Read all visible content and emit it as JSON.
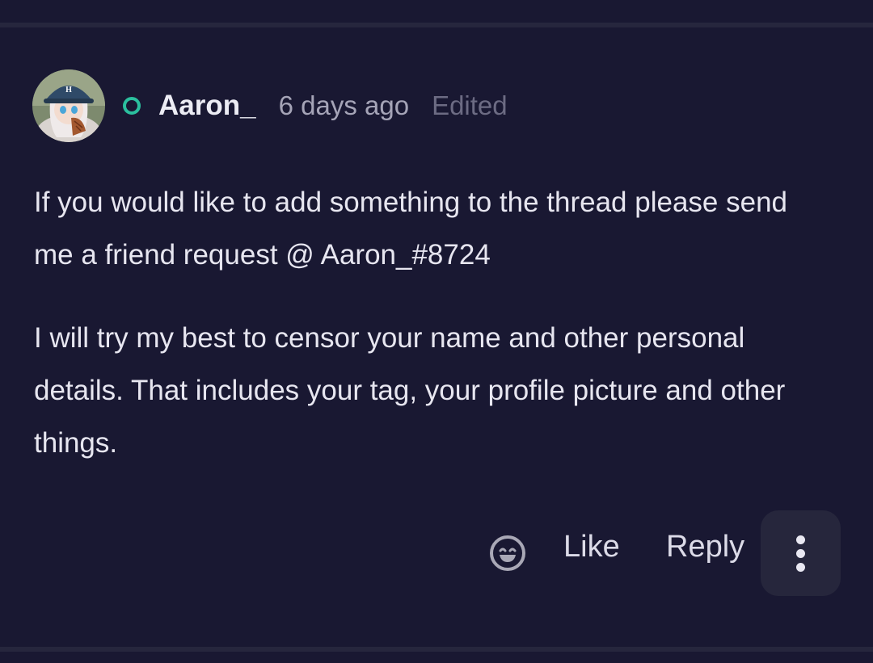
{
  "post": {
    "author": {
      "name": "Aaron_",
      "avatar_icon": "anime-avatar-icon",
      "status": "online",
      "status_color": "#2bbf9e"
    },
    "timestamp": "6 days ago",
    "edited_label": "Edited",
    "paragraphs": [
      "If you would like to add something to the thread please send me a friend request @ Aaron_#8724",
      "I will try my best to censor your name and other personal details. That includes your tag, your profile picture and other things."
    ]
  },
  "actions": {
    "reaction_icon": "smiley-face-icon",
    "like_label": "Like",
    "reply_label": "Reply",
    "more_icon": "more-vertical-icon"
  },
  "colors": {
    "background": "#191832",
    "divider": "#26263d",
    "more_button_bg": "#26263c"
  }
}
